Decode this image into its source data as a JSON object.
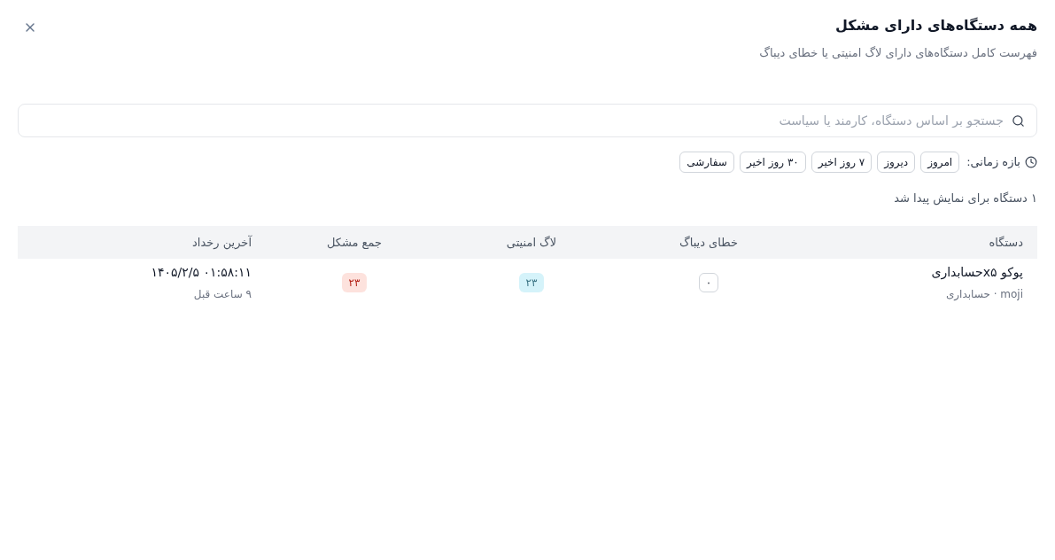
{
  "dialog": {
    "title": "همه دستگاه‌های دارای مشکل",
    "subtitle": "فهرست کامل دستگاه‌های دارای لاگ امنیتی یا خطای دیباگ"
  },
  "search": {
    "placeholder": "جستجو بر اساس دستگاه، کارمند یا سیاست"
  },
  "time_range": {
    "label": "بازه زمانی:",
    "options": [
      {
        "label": "امروز",
        "selected": false
      },
      {
        "label": "دیروز",
        "selected": false
      },
      {
        "label": "۷ روز اخیر",
        "selected": false
      },
      {
        "label": "۳۰ روز اخیر",
        "selected": false
      },
      {
        "label": "سفارشی",
        "selected": false
      }
    ]
  },
  "result_count": "۱ دستگاه برای نمایش پیدا شد",
  "table": {
    "columns": [
      "دستگاه",
      "خطای دیباگ",
      "لاگ امنیتی",
      "جمع مشکل",
      "آخرین رخداد"
    ],
    "rows": [
      {
        "device": "پوکو x۵حسابداری",
        "details": "moji · حسابداری",
        "debug_errors": "۰",
        "security_logs": "۲۳",
        "total_issues": "۲۳",
        "last_event": "۱۴۰۵/۲/۵ ۰۱:۵۸:۱۱",
        "last_event_relative": "۹ ساعت قبل"
      }
    ]
  }
}
